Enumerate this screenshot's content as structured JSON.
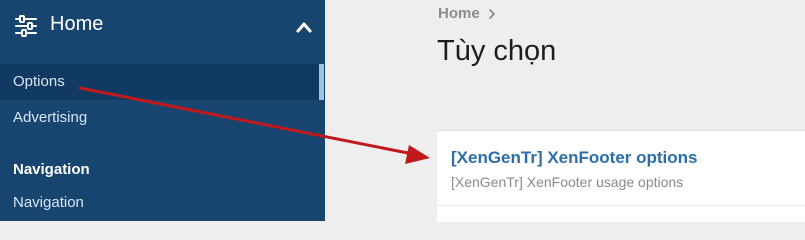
{
  "sidebar": {
    "header": {
      "label": "Home",
      "icon": "sliders-icon",
      "toggle_icon": "chevron-up-icon"
    },
    "items": [
      {
        "label": "Options",
        "active": true
      },
      {
        "label": "Advertising"
      }
    ],
    "sections": [
      {
        "title": "Navigation",
        "items": [
          {
            "label": "Navigation"
          }
        ]
      }
    ]
  },
  "main": {
    "breadcrumb": "Home",
    "title": "Tùy chọn",
    "option_group": {
      "title": "[XenGenTr] XenFooter options",
      "description": "[XenGenTr] XenFooter usage options"
    }
  },
  "annotation": {
    "arrow_color": "#c0191c"
  },
  "colors": {
    "sidebar_bg": "#17456f",
    "link": "#2b6ea9"
  }
}
